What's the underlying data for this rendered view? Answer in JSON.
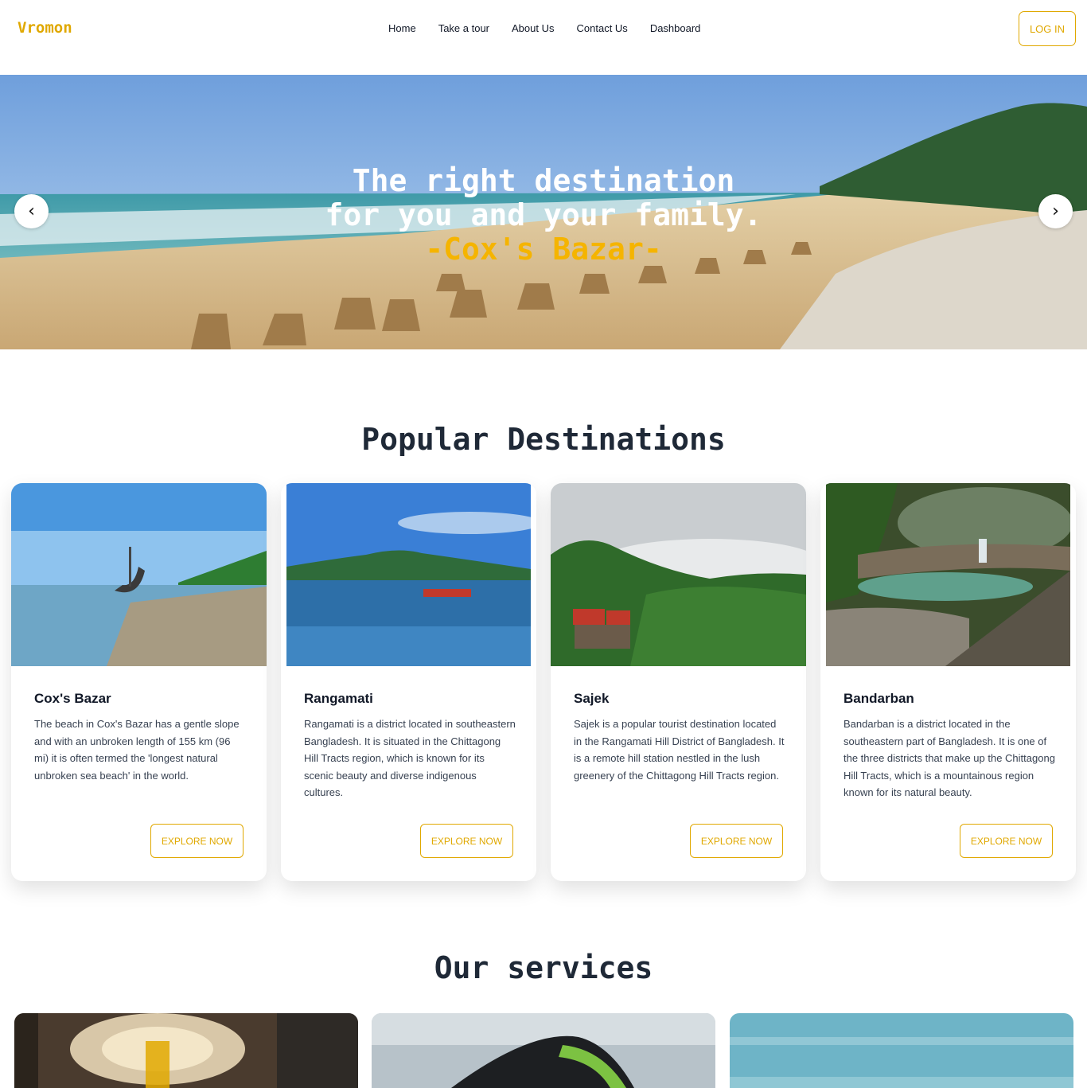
{
  "brand": {
    "logo": "Vromon",
    "accent": "#e0a800"
  },
  "nav": {
    "items": [
      {
        "label": "Home"
      },
      {
        "label": "Take a tour"
      },
      {
        "label": "About Us"
      },
      {
        "label": "Contact Us"
      },
      {
        "label": "Dashboard"
      }
    ],
    "login_label": "LOG IN"
  },
  "hero": {
    "line1": "The right destination",
    "line2": "for you and your family.",
    "location": "-Cox's Bazar-",
    "prev_icon": "‹",
    "next_icon": "›"
  },
  "popular": {
    "title": "Popular Destinations",
    "cards": [
      {
        "title": "Cox's Bazar",
        "description": "The beach in Cox's Bazar has a gentle slope and with an unbroken length of 155 km (96 mi) it is often termed the 'longest natural unbroken sea beach' in the world.",
        "button": "EXPLORE NOW",
        "image": "coxs-bazar-boat-image"
      },
      {
        "title": "Rangamati",
        "description": "Rangamati is a district located in southeastern Bangladesh. It is situated in the Chittagong Hill Tracts region, which is known for its scenic beauty and diverse indigenous cultures.",
        "button": "EXPLORE NOW",
        "image": "rangamati-lake-image"
      },
      {
        "title": "Sajek",
        "description": "Sajek is a popular tourist destination located in the Rangamati Hill District of Bangladesh. It is a remote hill station nestled in the lush greenery of the Chittagong Hill Tracts region.",
        "button": "EXPLORE NOW",
        "image": "sajek-hills-image"
      },
      {
        "title": "Bandarban",
        "description": "Bandarban is a district located in the southeastern part of Bangladesh. It is one of the three districts that make up the Chittagong Hill Tracts, which is a mountainous region known for its natural beauty.",
        "button": "EXPLORE NOW",
        "image": "bandarban-waterfall-image"
      }
    ]
  },
  "services": {
    "title": "Our services",
    "cards": [
      {
        "image": "hotel-lobby-image"
      },
      {
        "image": "bus-image"
      },
      {
        "image": "sky-sea-image"
      }
    ]
  }
}
